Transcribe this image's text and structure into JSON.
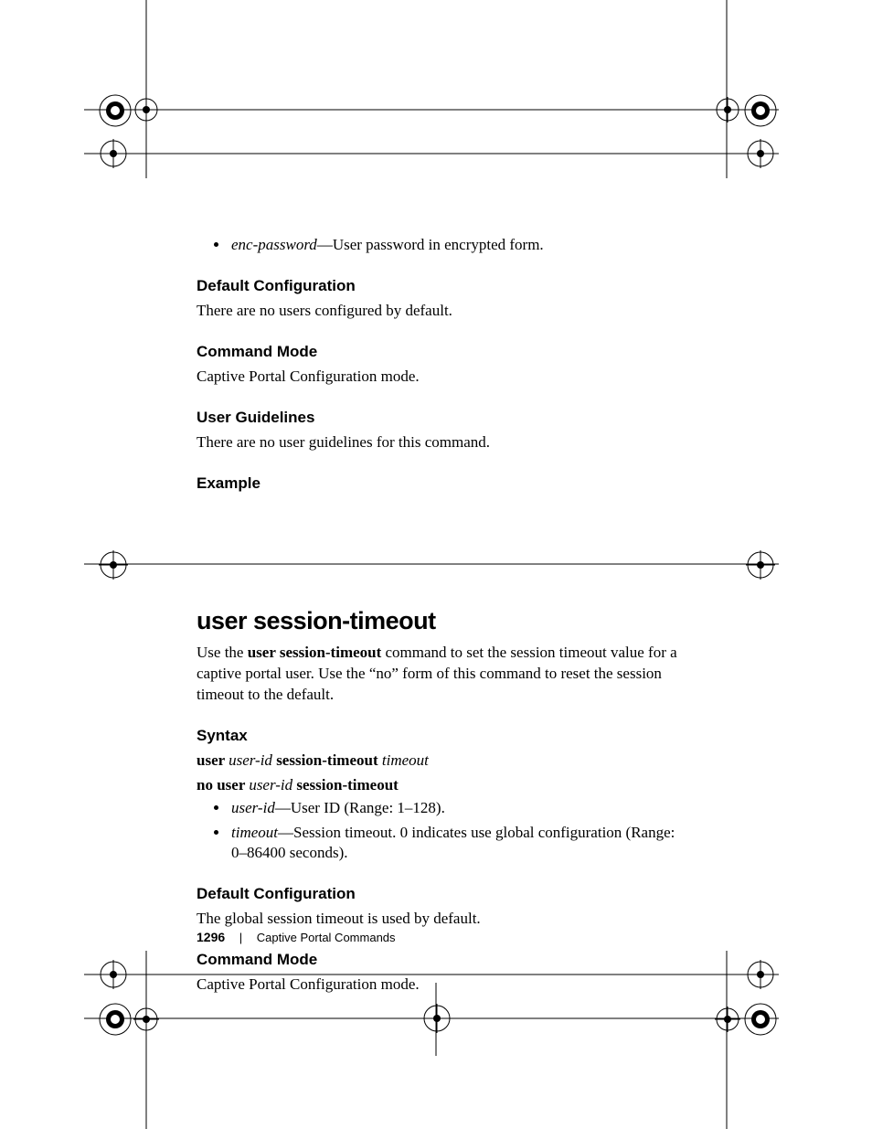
{
  "bullets_top": {
    "enc_password_term": "enc-password",
    "enc_password_desc": "—User password in encrypted form."
  },
  "sec1": {
    "default_cfg_h": "Default Configuration",
    "default_cfg_p": "There are no users configured by default.",
    "cmd_mode_h": "Command Mode",
    "cmd_mode_p": "Captive Portal Configuration mode.",
    "user_guide_h": "User Guidelines",
    "user_guide_p": "There are no user guidelines for this command.",
    "example_h": "Example"
  },
  "cmd": {
    "title": "user session-timeout",
    "intro_pre": "Use the ",
    "intro_bold": "user session-timeout",
    "intro_post": " command to set the session timeout value for a captive portal user. Use the “no” form of this command to reset the session timeout to the default."
  },
  "syntax": {
    "h": "Syntax",
    "l1_a_bold": "user ",
    "l1_b_ital": "user-id",
    "l1_c_bold": " session-timeout ",
    "l1_d_ital": "timeout",
    "l2_a_bold": "no user ",
    "l2_b_ital": "user-id",
    "l2_c_bold": " session-timeout",
    "b1_term": "user-id",
    "b1_desc": "—User ID (Range: 1–128).",
    "b2_term": "timeout",
    "b2_desc": "—Session timeout. 0 indicates use global configuration (Range: 0–86400 seconds)."
  },
  "sec2": {
    "default_cfg_h": "Default Configuration",
    "default_cfg_p": "The global session timeout is used by default.",
    "cmd_mode_h": "Command Mode",
    "cmd_mode_p": "Captive Portal Configuration mode."
  },
  "footer": {
    "page": "1296",
    "sep": "|",
    "title": "Captive Portal Commands"
  }
}
